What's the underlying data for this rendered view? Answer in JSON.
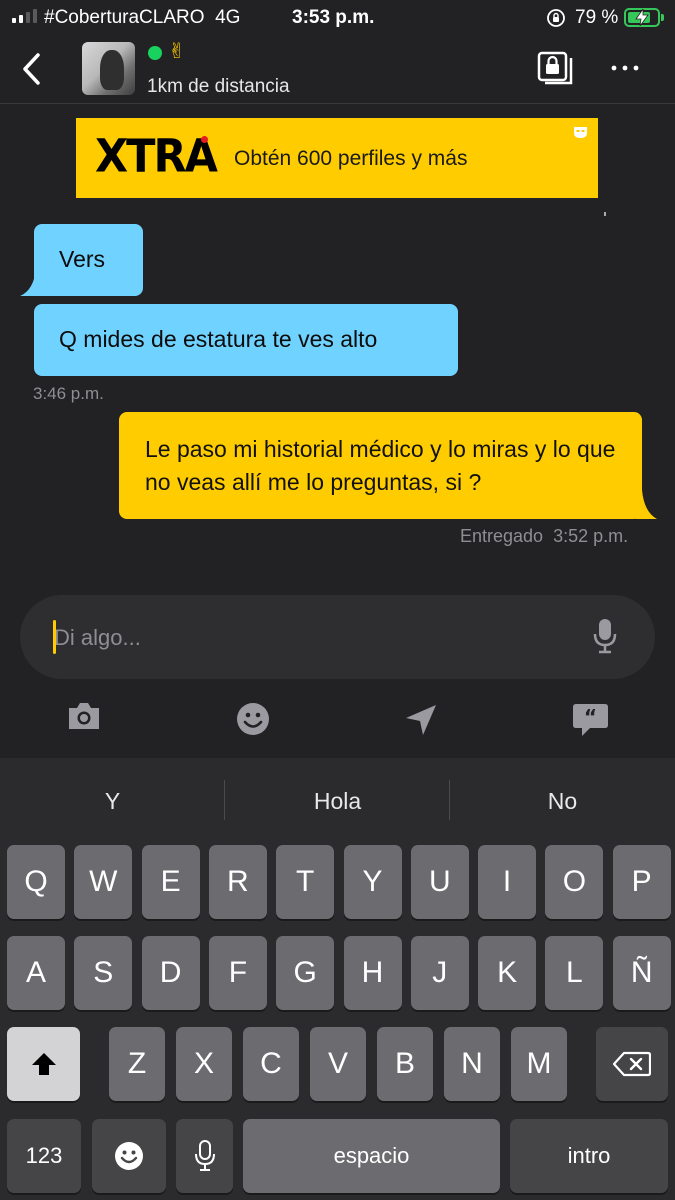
{
  "status_bar": {
    "carrier": "#CoberturaCLARO",
    "network": "4G",
    "time": "3:53 p.m.",
    "battery_percent_label": "79 %",
    "battery_level": 0.79
  },
  "header": {
    "status_emoji": "✌",
    "distance": "1km de distancia",
    "icons": [
      "back-icon",
      "private-album-icon",
      "more-icon"
    ]
  },
  "banner": {
    "logo": "XTRA",
    "text": "Obtén 600 perfiles y más"
  },
  "messages": [
    {
      "direction": "incoming",
      "text": "Vers"
    },
    {
      "direction": "incoming",
      "text": "Q mides de estatura te ves alto",
      "time": "3:46 p.m."
    },
    {
      "direction": "outgoing",
      "text": "Le paso mi historial médico y lo miras y lo que no veas allí me lo preguntas, si ?",
      "status": "Entregado",
      "time": "3:52 p.m."
    }
  ],
  "composer": {
    "placeholder": "Di algo...",
    "tools": [
      "camera-icon",
      "emoji-icon",
      "location-icon",
      "quick-replies-icon"
    ]
  },
  "keyboard": {
    "suggestions": [
      "Y",
      "Hola",
      "No"
    ],
    "row1": [
      "Q",
      "W",
      "E",
      "R",
      "T",
      "Y",
      "U",
      "I",
      "O",
      "P"
    ],
    "row2": [
      "A",
      "S",
      "D",
      "F",
      "G",
      "H",
      "J",
      "K",
      "L",
      "Ñ"
    ],
    "row3": [
      "Z",
      "X",
      "C",
      "V",
      "B",
      "N",
      "M"
    ],
    "numbers_key": "123",
    "space_key": "espacio",
    "return_key": "intro"
  },
  "colors": {
    "background": "#222224",
    "incoming_bubble": "#6fd2ff",
    "outgoing_bubble": "#ffcc00",
    "online": "#19d15e",
    "battery": "#35c759"
  }
}
